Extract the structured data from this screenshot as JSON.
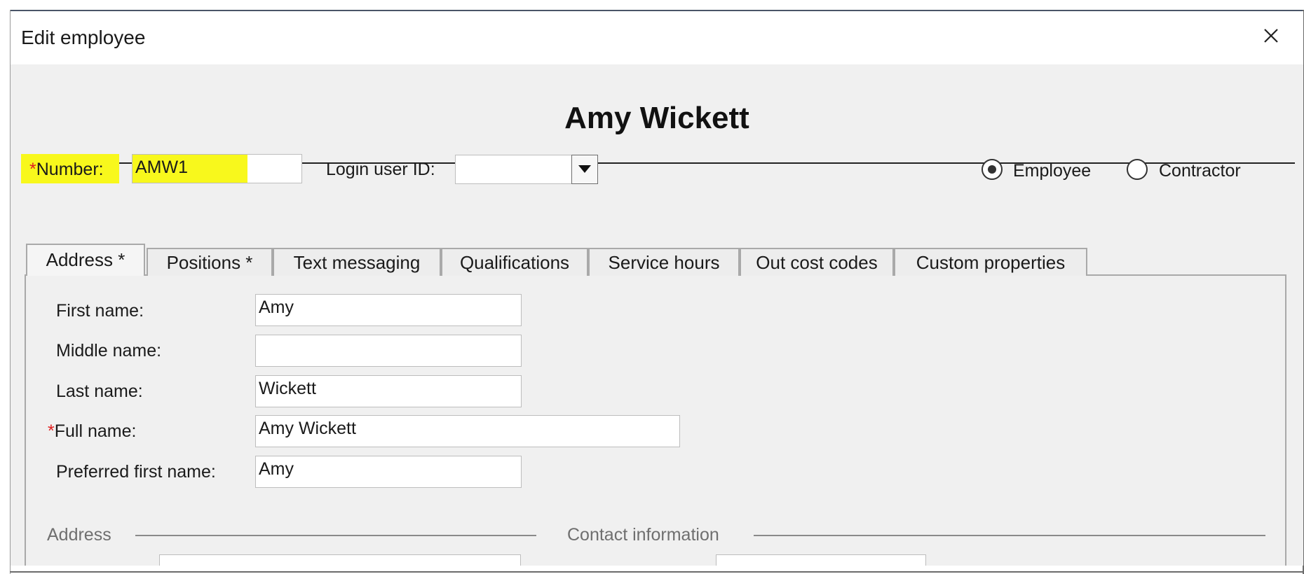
{
  "dialog": {
    "title": "Edit employee"
  },
  "employee": {
    "display_name": "Amy Wickett"
  },
  "header": {
    "number_label": "Number:",
    "number_value": "AMW1",
    "login_label": "Login user ID:",
    "login_value": "",
    "type_options": [
      {
        "label": "Employee",
        "selected": true
      },
      {
        "label": "Contractor",
        "selected": false
      }
    ]
  },
  "tabs": [
    {
      "label": "Address *",
      "active": true
    },
    {
      "label": "Positions *",
      "active": false
    },
    {
      "label": "Text messaging",
      "active": false
    },
    {
      "label": "Qualifications",
      "active": false
    },
    {
      "label": "Service hours",
      "active": false
    },
    {
      "label": "Out cost codes",
      "active": false
    },
    {
      "label": "Custom properties",
      "active": false
    }
  ],
  "address_tab": {
    "first_name": {
      "label": "First name:",
      "value": "Amy"
    },
    "middle_name": {
      "label": "Middle name:",
      "value": ""
    },
    "last_name": {
      "label": "Last name:",
      "value": "Wickett"
    },
    "full_name": {
      "label": "Full name:",
      "value": "Amy Wickett",
      "required": true
    },
    "preferred_first_name": {
      "label": "Preferred first name:",
      "value": "Amy"
    },
    "sections": {
      "address": "Address",
      "contact": "Contact information"
    }
  },
  "colors": {
    "highlight": "#f8f81c",
    "required_marker": "#e02020",
    "dialog_body": "#f0f0f0"
  },
  "icons": {
    "close": "close-icon",
    "dropdown": "chevron-down-icon"
  }
}
